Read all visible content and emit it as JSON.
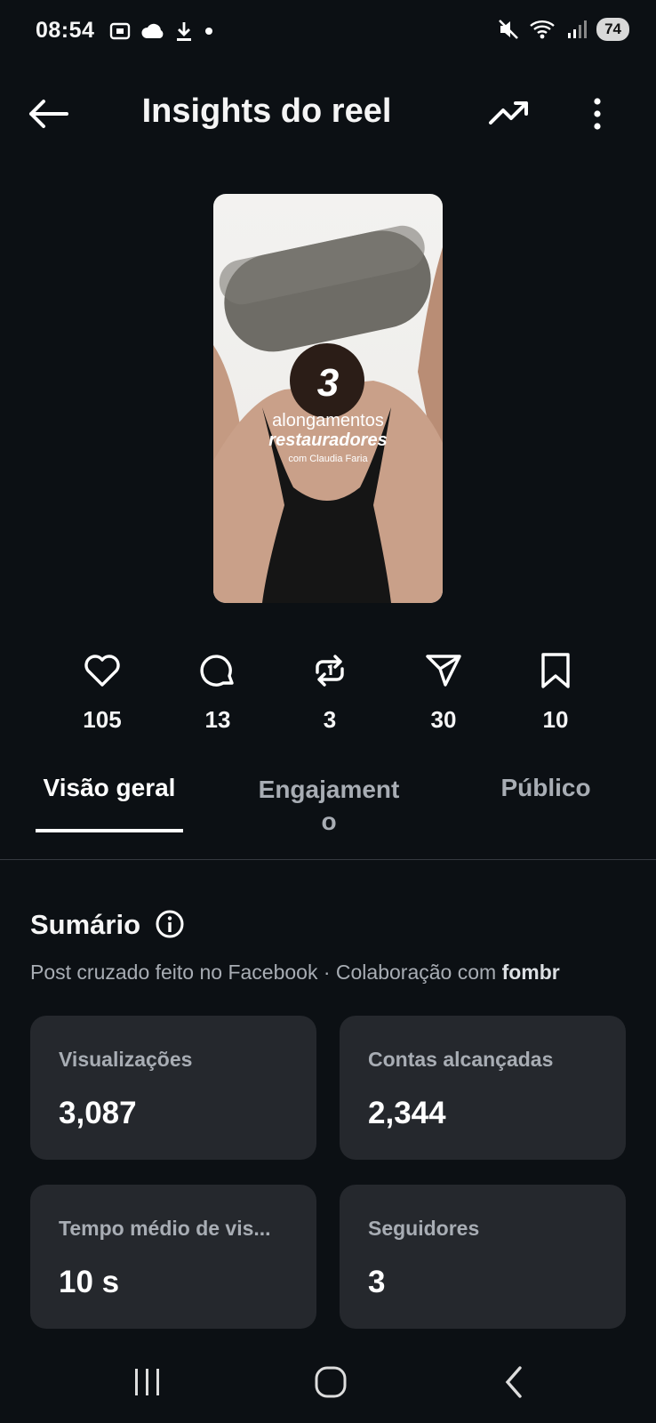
{
  "status_bar": {
    "time": "08:54",
    "battery": "74",
    "icons_left": [
      "screenshot-icon",
      "cloud-icon",
      "download-icon",
      "dot-icon"
    ],
    "icons_right": [
      "mute-icon",
      "wifi-icon",
      "signal-icon",
      "battery-icon"
    ]
  },
  "header": {
    "title": "Insights do reel",
    "icons": [
      "back-arrow-icon",
      "trend-icon",
      "more-vertical-icon"
    ]
  },
  "thumbnail": {
    "number": "3",
    "line1": "alongamentos",
    "line2": "restauradores",
    "line3": "com Claudia Faria"
  },
  "stats": [
    {
      "icon": "heart-icon",
      "value": "105"
    },
    {
      "icon": "comment-icon",
      "value": "13"
    },
    {
      "icon": "repost-icon",
      "value": "3"
    },
    {
      "icon": "share-icon",
      "value": "30"
    },
    {
      "icon": "bookmark-icon",
      "value": "10"
    }
  ],
  "tabs": {
    "overview": "Visão geral",
    "engagement_1": "Engajament",
    "engagement_2": "o",
    "audience": "Público",
    "selected": "overview"
  },
  "summary": {
    "title": "Sumário",
    "subtitle_prefix": "Post cruzado feito no Facebook · Colaboração com ",
    "subtitle_bold": "fombr",
    "cards": [
      {
        "label": "Visualizações",
        "value": "3,087"
      },
      {
        "label": "Contas alcançadas",
        "value": "2,344"
      },
      {
        "label": "Tempo médio de vis...",
        "value": "10 s"
      },
      {
        "label": "Seguidores",
        "value": "3"
      }
    ]
  },
  "colors": {
    "background": "#0c1014",
    "card": "#25282d",
    "muted_text": "#a8adb4"
  }
}
